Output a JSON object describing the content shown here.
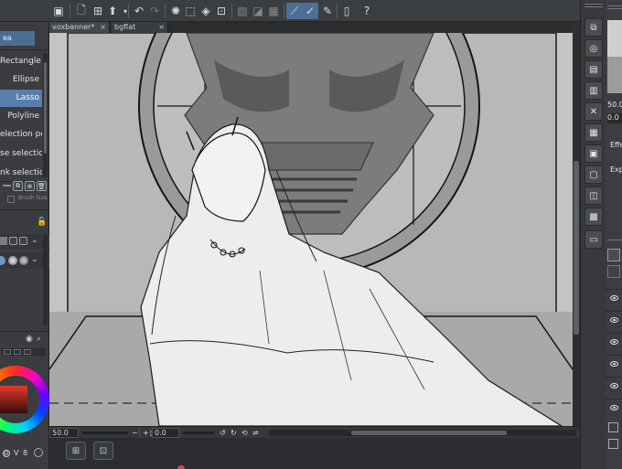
{
  "document_tabs": [
    {
      "label": "voxbanner*",
      "active": true
    },
    {
      "label": "bgflat",
      "active": false
    }
  ],
  "left_panel": {
    "header_label": "ea",
    "subtools": [
      {
        "label": "Rectangle",
        "active": false
      },
      {
        "label": "Ellipse",
        "active": false
      },
      {
        "label": "Lasso",
        "active": true
      },
      {
        "label": "Polyline",
        "active": false
      },
      {
        "label": "election pen",
        "active": false
      },
      {
        "label": "se selection",
        "active": false
      },
      {
        "label": "nk selection",
        "active": false
      }
    ],
    "brush_size_label": "Brush Size",
    "color_values": [
      "0",
      "8"
    ]
  },
  "status_bar": {
    "zoom": "50.0",
    "angle": "0.0"
  },
  "right_panel": {
    "value_1": "50.0",
    "value_2": "0.0",
    "label_1": "Effe",
    "label_2": "Exp"
  },
  "icons": {
    "undo": "undo-icon",
    "redo": "redo-icon",
    "new": "new-file-icon",
    "save": "save-icon",
    "help": "help-icon"
  },
  "colors": {
    "accent": "#597eab",
    "panel": "#3a3c3f",
    "canvas_bg": "#bdbdbd"
  }
}
